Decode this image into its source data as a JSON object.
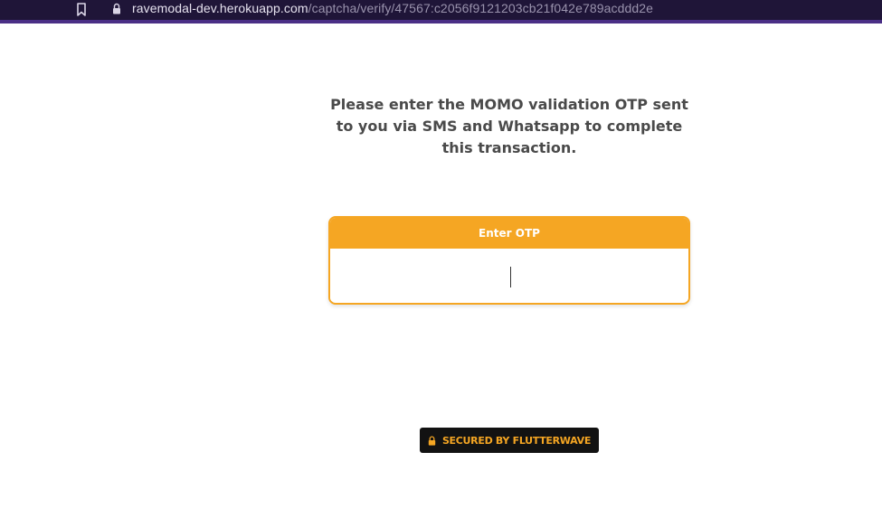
{
  "browser": {
    "url_host": "ravemodal-dev.herokuapp.com",
    "url_path": "/captcha/verify/47567:c2056f9121203cb21f042e789acddd2e",
    "bookmark_icon": "bookmark-icon",
    "lock_icon": "lock-icon"
  },
  "main": {
    "instructions": "Please enter the MOMO validation OTP sent to you via SMS and Whatsapp to complete this transaction."
  },
  "otp": {
    "header_label": "Enter OTP",
    "value": "",
    "placeholder": ""
  },
  "footer": {
    "badge_label": "SECURED BY FLUTTERWAVE",
    "badge_icon": "lock-icon"
  },
  "colors": {
    "accent": "#f5a623",
    "browser_bar": "#1f1538",
    "badge_bg": "#121212",
    "text": "#4a4a4a"
  }
}
